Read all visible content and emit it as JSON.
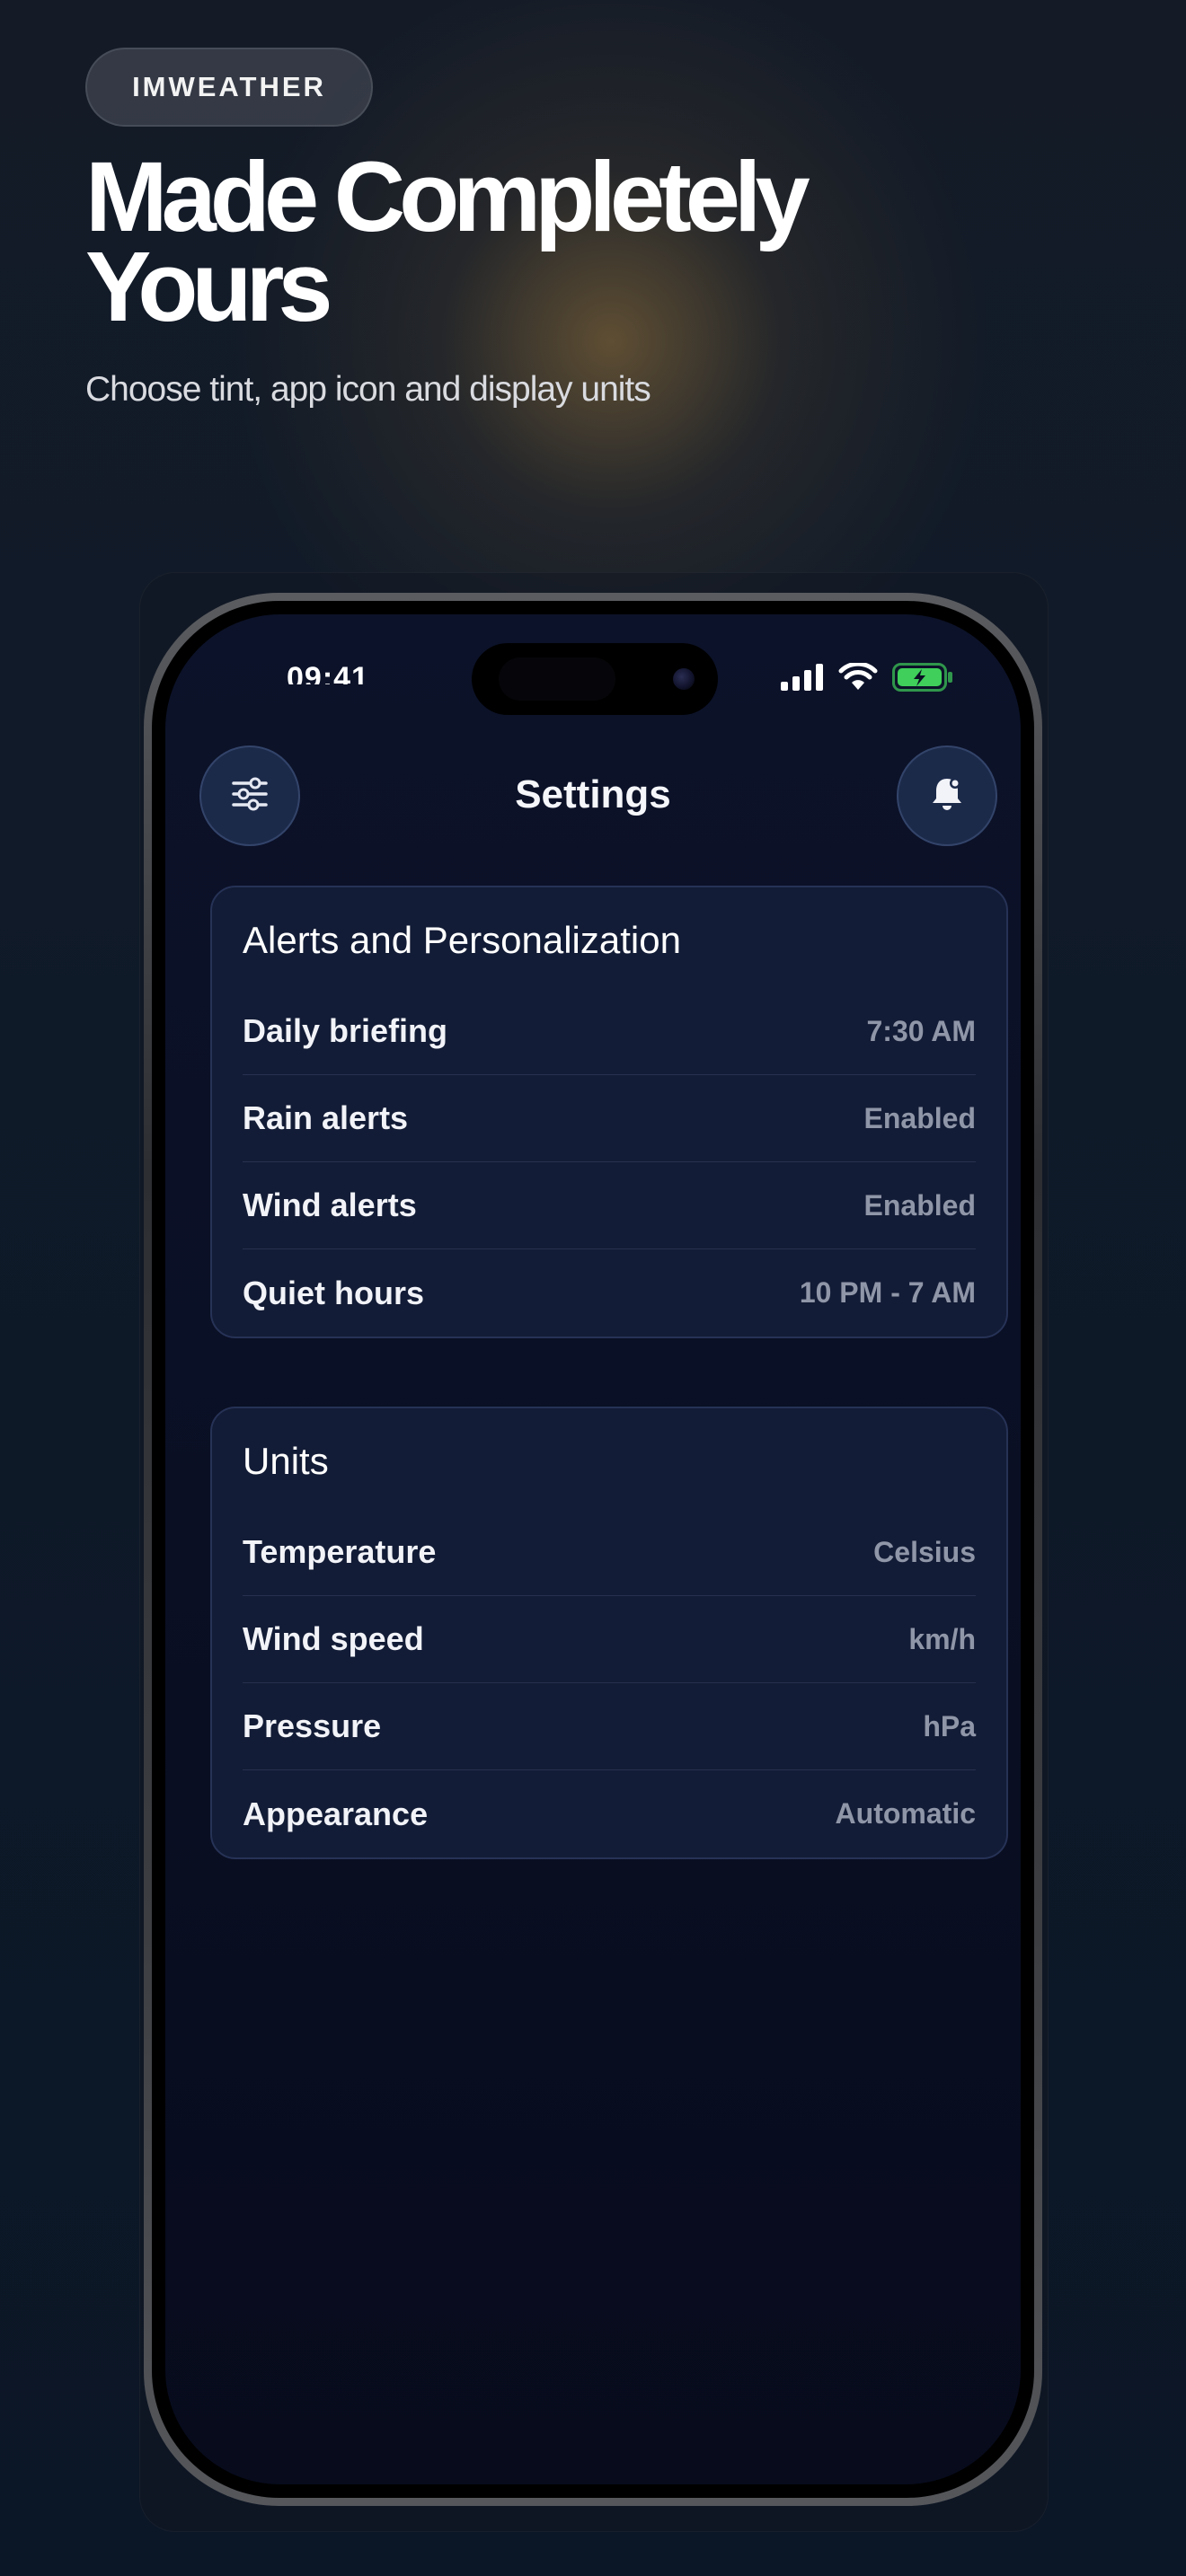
{
  "header": {
    "badge": "IMWEATHER",
    "headline_line1": "Made Completely",
    "headline_line2": "Yours",
    "subline": "Choose tint, app icon and display units"
  },
  "status_bar": {
    "time": "09:41"
  },
  "app": {
    "title": "Settings",
    "left_button_icon": "sliders-icon",
    "right_button_icon": "bell-icon"
  },
  "alerts_card": {
    "title": "Alerts and Personalization",
    "rows": [
      {
        "label": "Daily briefing",
        "value": "7:30 AM"
      },
      {
        "label": "Rain alerts",
        "value": "Enabled"
      },
      {
        "label": "Wind alerts",
        "value": "Enabled"
      },
      {
        "label": "Quiet hours",
        "value": "10 PM - 7 AM"
      }
    ]
  },
  "units_card": {
    "title": "Units",
    "rows": [
      {
        "label": "Temperature",
        "value": "Celsius"
      },
      {
        "label": "Wind speed",
        "value": "km/h"
      },
      {
        "label": "Pressure",
        "value": "hPa"
      },
      {
        "label": "Appearance",
        "value": "Automatic"
      }
    ]
  },
  "colors": {
    "battery_fill": "#3fcf5a",
    "card_background": "#131c36",
    "button_background": "#1c2a4a"
  }
}
